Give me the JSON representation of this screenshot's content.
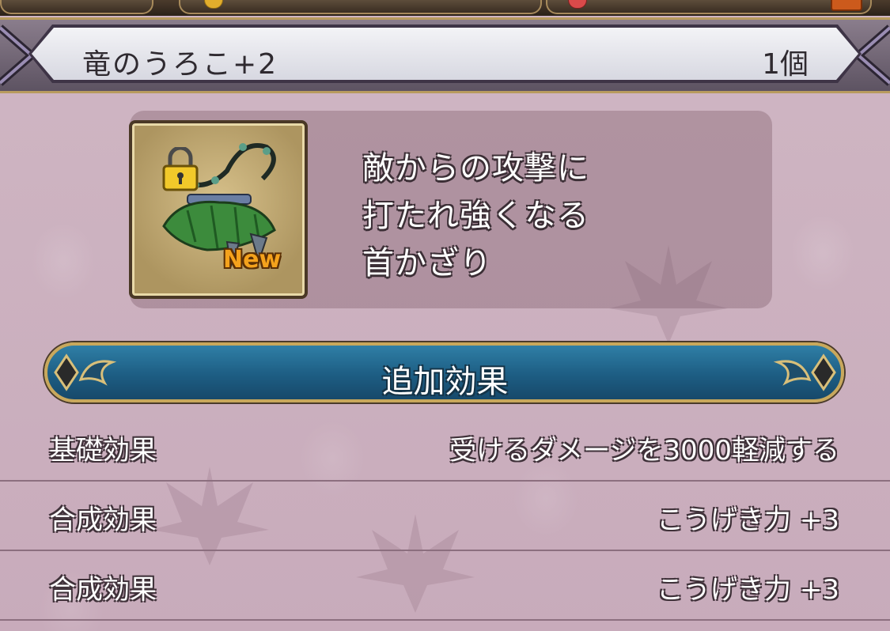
{
  "item": {
    "name": "竜のうろこ+2",
    "quantity": "1個",
    "badge": "New",
    "icon": "dragon-scale-necklace-icon",
    "locked_icon": "padlock-icon",
    "description": [
      "敵からの攻撃に",
      "打たれ強くなる",
      "首かざり"
    ]
  },
  "section": {
    "title": "追加効果"
  },
  "effects": [
    {
      "label": "基礎効果",
      "value": "受けるダメージを3000軽減する"
    },
    {
      "label": "合成効果",
      "value": "こうげき力 +3"
    },
    {
      "label": "合成効果",
      "value": "こうげき力 +3"
    }
  ],
  "colors": {
    "background": "#cdb2c0",
    "section_bar": "#1d5d83",
    "header_plate": "#e6e7ed",
    "gold_trim": "#c8a85c",
    "new_badge": "#f4a21c"
  }
}
